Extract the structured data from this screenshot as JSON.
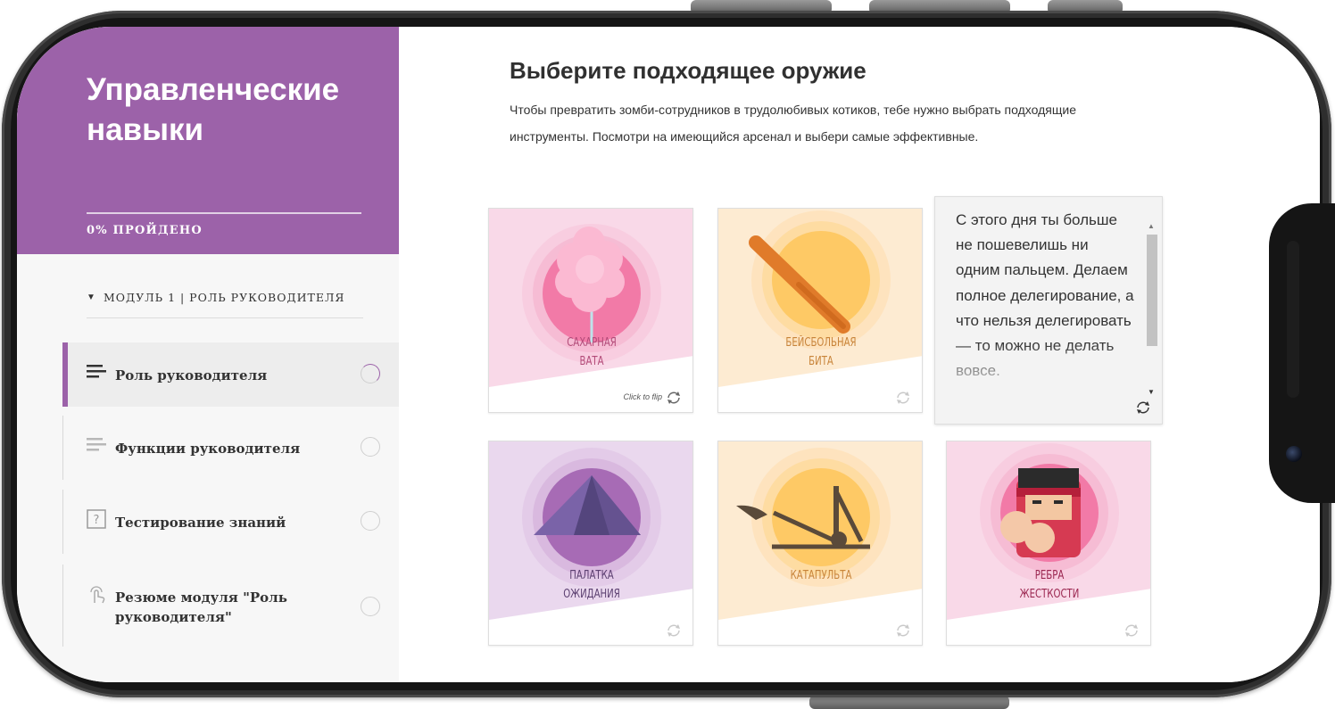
{
  "sidebar": {
    "course_title": "Управленческие навыки",
    "progress": {
      "text": "0% ПРОЙДЕНО",
      "percent": 0
    },
    "module": {
      "label": "МОДУЛЬ 1 | РОЛЬ РУКОВОДИТЕЛЯ",
      "expanded": true
    },
    "lessons": [
      {
        "label": "Роль руководителя",
        "icon": "text-lines-icon",
        "active": true
      },
      {
        "label": "Функции руководителя",
        "icon": "text-lines-icon",
        "active": false
      },
      {
        "label": "Тестирование знаний",
        "icon": "question-icon",
        "active": false
      },
      {
        "label": "Резюме модуля \"Роль руководителя\"",
        "icon": "tap-icon",
        "active": false
      }
    ]
  },
  "main": {
    "title": "Выберите подходящее оружие",
    "description": "Чтобы превратить зомби-сотрудников в трудолюбивых котиков, тебе нужно выбрать подходящие инструменты. Посмотри на имеющийся арсенал и выбери самые эффективные.",
    "cards": [
      {
        "label": "САХАРНАЯ\nВАТА",
        "hint": "Click to flip",
        "image": "cotton-candy",
        "bg": "#f9d9e8",
        "circle": "#f27aa7",
        "label_color": "#b24a78"
      },
      {
        "label": "БЕЙСБОЛЬНАЯ\nБИТА",
        "image": "baseball-bat",
        "bg": "#fdebd2",
        "circle": "#fec965",
        "label_color": "#c8843a"
      },
      {
        "back_text": "С этого дня ты больше не пошевелишь ни одним пальцем. Делаем полное делегирование, а что нельзя делегировать — то можно не делать вовсе.",
        "flipped": true
      },
      {
        "label": "ПАЛАТКА\nОЖИДАНИЯ",
        "image": "tent",
        "bg": "#ead8ee",
        "circle": "#a76bb5",
        "label_color": "#5b3f70"
      },
      {
        "label": "КАТАПУЛЬТА",
        "image": "catapult",
        "bg": "#fdebd2",
        "circle": "#fec965",
        "label_color": "#c8843a"
      },
      {
        "label": "РЕБРА\nЖЕСТКОСТИ",
        "image": "fighter",
        "bg": "#f9d9e8",
        "circle": "#f27aa7",
        "label_color": "#9b2650"
      }
    ]
  },
  "colors": {
    "accent": "#9c62a9",
    "frame": "#2e2e2e"
  }
}
